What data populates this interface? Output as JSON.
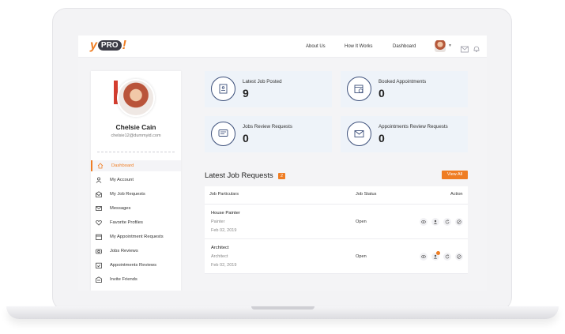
{
  "header": {
    "logo_text_y": "y",
    "logo_text_pro": "PRO",
    "logo_text_bang": "!",
    "nav": [
      "About Us",
      "How It Works",
      "Dashboard"
    ]
  },
  "profile": {
    "name": "Chelsie Cain",
    "email": "chelsie12@dummyid.com"
  },
  "sidebar": {
    "items": [
      {
        "label": "Dashboard",
        "icon": "home-icon",
        "active": true
      },
      {
        "label": "My Account",
        "icon": "user-icon",
        "active": false
      },
      {
        "label": "My Job Requests",
        "icon": "envelope-open-icon",
        "active": false
      },
      {
        "label": "Messages",
        "icon": "mail-icon",
        "active": false
      },
      {
        "label": "Favorite Profiles",
        "icon": "heart-icon",
        "active": false
      },
      {
        "label": "My Appointment Requests",
        "icon": "calendar-icon",
        "active": false
      },
      {
        "label": "Jobs Reviews",
        "icon": "camera-icon",
        "active": false
      },
      {
        "label": "Appointments Reviews",
        "icon": "calendar-check-icon",
        "active": false
      },
      {
        "label": "Invite Friends",
        "icon": "invite-icon",
        "active": false
      }
    ]
  },
  "stats": [
    {
      "label": "Latest Job Posted",
      "value": "9",
      "icon": "job-document-icon"
    },
    {
      "label": "Booked Appointments",
      "value": "0",
      "icon": "calendar-clock-icon"
    },
    {
      "label": "Jobs Review Requests",
      "value": "0",
      "icon": "chat-lines-icon"
    },
    {
      "label": "Appointments Review Requests",
      "value": "0",
      "icon": "envelope-icon"
    }
  ],
  "jobs": {
    "title": "Latest Job Requests",
    "count": "2",
    "view_all": "View All",
    "columns": [
      "Job Particulars",
      "Job Status",
      "Action"
    ],
    "rows": [
      {
        "title": "House Painter",
        "category": "Painter",
        "date": "Feb 02, 2019",
        "status": "Open",
        "has_notification": false
      },
      {
        "title": "Architect",
        "category": "Architect",
        "date": "Feb 02, 2019",
        "status": "Open",
        "has_notification": true
      }
    ]
  },
  "colors": {
    "accent": "#ef7d23",
    "card_bg": "#eef3f9",
    "icon_ring": "#3c4f7a"
  }
}
